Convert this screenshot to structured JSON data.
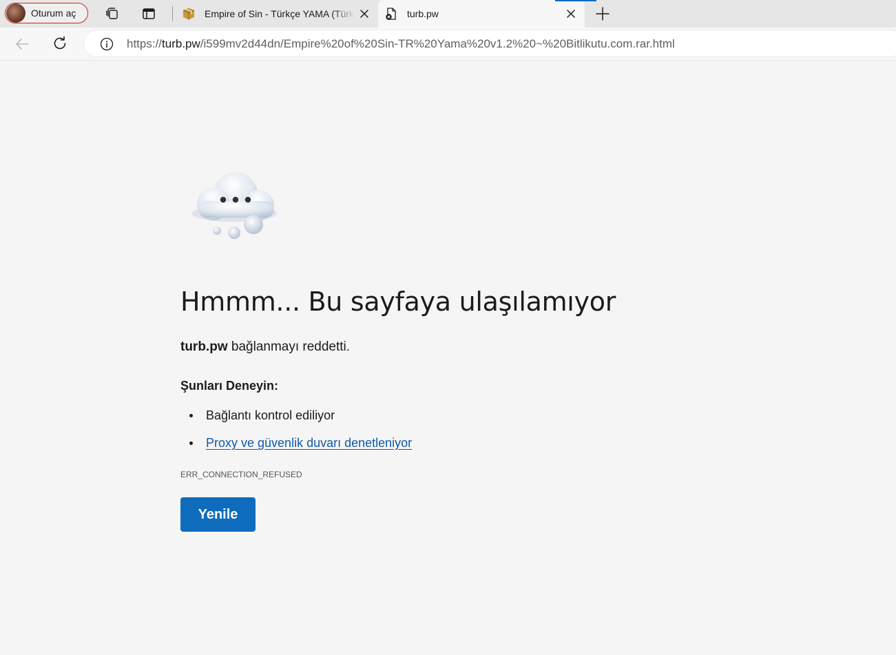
{
  "profile": {
    "label": "Oturum aç"
  },
  "tabs": [
    {
      "title": "Empire of Sin - Türkçe YAMA (Türkçe Yama)",
      "favicon": "package-icon",
      "active": false
    },
    {
      "title": "turb.pw",
      "favicon": "page-error-icon",
      "active": true
    }
  ],
  "address": {
    "scheme": "https://",
    "host": "turb.pw",
    "path": "/i599mv2d44dn/Empire%20of%20Sin-TR%20Yama%20v1.2%20~%20Bitlikutu.com.rar.html"
  },
  "error": {
    "title": "Hmmm... Bu sayfaya ulaşılamıyor",
    "host": "turb.pw",
    "description": "bağlanmayı reddetti.",
    "try_heading": "Şunları Deneyin:",
    "suggestions": [
      "Bağlantı kontrol ediliyor",
      "Proxy ve güvenlik duvarı denetleniyor"
    ],
    "code": "ERR_CONNECTION_REFUSED",
    "reload_label": "Yenile"
  },
  "colors": {
    "accent": "#0f6cbd",
    "link": "#0f5aa8",
    "profile_border": "#c42b1c"
  }
}
